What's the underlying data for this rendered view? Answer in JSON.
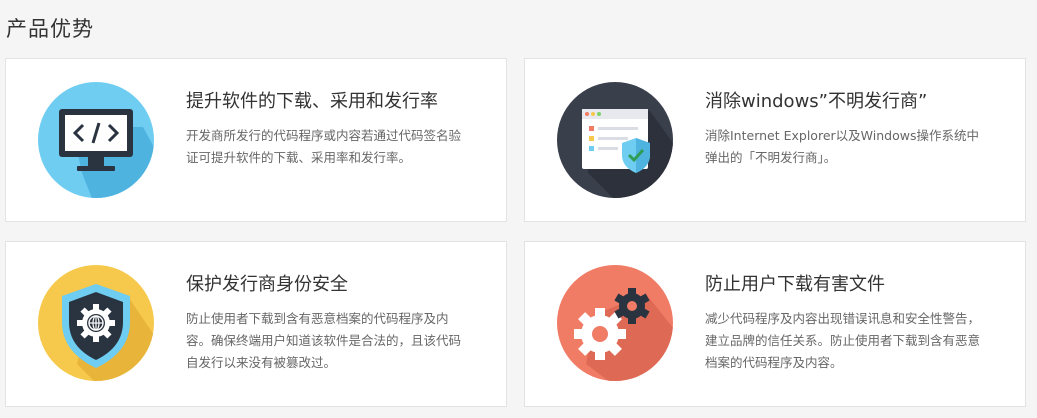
{
  "section": {
    "title": "产品优势"
  },
  "cards": [
    {
      "title": "提升软件的下载、采用和发行率",
      "desc": "开发商所发行的代码程序或内容若通过代码签名验证可提升软件的下载、采用率和发行率。",
      "icon": "code-monitor-icon",
      "icon_color": "#6fcdf2"
    },
    {
      "title": "消除windows”不明发行商”",
      "desc": "消除Internet Explorer以及Windows操作系统中弹出的「不明发行商」。",
      "icon": "browser-shield-icon",
      "icon_color": "#3a3f4c"
    },
    {
      "title": "保护发行商身份安全",
      "desc": "防止使用者下载到含有恶意档案的代码程序及内容。确保终端用户知道该软件是合法的，且该代码自发行以来没有被篡改过。",
      "icon": "shield-gear-icon",
      "icon_color": "#f6c94d"
    },
    {
      "title": "防止用户下载有害文件",
      "desc": "减少代码程序及内容出现错误讯息和安全性警告，建立品牌的信任关系。防止使用者下载到含有恶意档案的代码程序及内容。",
      "icon": "gears-icon",
      "icon_color": "#f07c66"
    }
  ]
}
